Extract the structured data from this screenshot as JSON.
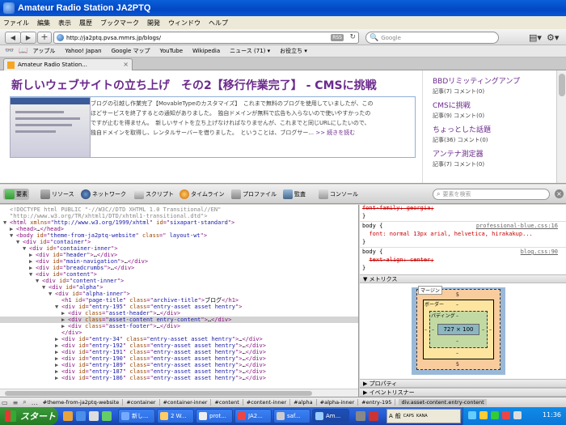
{
  "window": {
    "title": "Amateur Radio Station JA2PTQ"
  },
  "menu": [
    "ファイル",
    "編集",
    "表示",
    "履歴",
    "ブックマーク",
    "開発",
    "ウィンドウ",
    "ヘルプ"
  ],
  "nav": {
    "url": "http://ja2ptq.pvsa.mmrs.jp/blogs/",
    "rss_label": "RSS",
    "search_placeholder": "Google"
  },
  "bookmarks": [
    "アップル",
    "Yahoo! Japan",
    "Google マップ",
    "YouTube",
    "Wikipedia",
    "ニュース (71) ▾",
    "お役立ち ▾"
  ],
  "tab": {
    "label": "Amateur Radio Station...",
    "close": "×"
  },
  "page": {
    "post_title": "新しいウェブサイトの立ち上げ　その2【移行作業完了】",
    "post_title_suffix": " - CMSに挑戦",
    "post_lines": [
      "ブログの引越し作業完了【MovableTypeのカスタマイズ】　これまで無料のブログを使用していましたが、この",
      "ほどサービスを終了するとの通知がありました。　独自ドメインが無料で広告も入らないので使いやすかったの",
      "ですが止むを得ません。　新しいサイトを立ち上げなければなりませんが、これまでと同じURLにしたいので、",
      "独自ドメインを取得し、レンタルサーバーを借りました。　ということは、ブログサー..."
    ],
    "read_more": ">> 続きを読む",
    "sidebar": [
      {
        "title": "BBDリミッティングアンプ",
        "meta": "記事(7) コメント(0)"
      },
      {
        "title": "CMSに挑戦",
        "meta": "記事(9) コメント(0)"
      },
      {
        "title": "ちょっとした話題",
        "meta": "記事(36) コメント(0)"
      },
      {
        "title": "アンテナ測定器",
        "meta": "記事(7) コメント(0)"
      }
    ]
  },
  "inspector": {
    "tabs": [
      "要素",
      "リソース",
      "ネットワーク",
      "スクリプト",
      "タイムライン",
      "プロファイル",
      "監査",
      "コンソール"
    ],
    "search_placeholder": "要素を検索",
    "close": "×"
  },
  "dom": [
    {
      "indent": 0,
      "tw": "",
      "parts": [
        [
          "doc",
          "<!DOCTYPE html PUBLIC \"-//W3C//DTD XHTML 1.0 Transitional//EN\""
        ]
      ]
    },
    {
      "indent": 0,
      "tw": "",
      "parts": [
        [
          "doc",
          "\"http://www.w3.org/TR/xhtml1/DTD/xhtml1-transitional.dtd\">"
        ]
      ]
    },
    {
      "indent": 0,
      "tw": "▼",
      "parts": [
        [
          "tag",
          "<html "
        ],
        [
          "attr",
          "xmlns"
        ],
        [
          "tag",
          "=\""
        ],
        [
          "val",
          "http://www.w3.org/1999/xhtml"
        ],
        [
          "tag",
          "\" "
        ],
        [
          "attr",
          "id"
        ],
        [
          "tag",
          "=\""
        ],
        [
          "val",
          "sixapart-standard"
        ],
        [
          "tag",
          "\">"
        ]
      ]
    },
    {
      "indent": 1,
      "tw": "▶",
      "parts": [
        [
          "tag",
          "<head>"
        ],
        [
          "txt",
          "…"
        ],
        [
          "tag",
          "</head>"
        ]
      ]
    },
    {
      "indent": 1,
      "tw": "▼",
      "parts": [
        [
          "tag",
          "<body "
        ],
        [
          "attr",
          "id"
        ],
        [
          "tag",
          "=\""
        ],
        [
          "val",
          "theme-from-ja2ptq-website"
        ],
        [
          "tag",
          "\" "
        ],
        [
          "attr",
          "class"
        ],
        [
          "tag",
          "=\""
        ],
        [
          "val",
          " layout-wt"
        ],
        [
          "tag",
          "\">"
        ]
      ]
    },
    {
      "indent": 2,
      "tw": "▼",
      "parts": [
        [
          "tag",
          "<div "
        ],
        [
          "attr",
          "id"
        ],
        [
          "tag",
          "=\""
        ],
        [
          "val",
          "container"
        ],
        [
          "tag",
          "\">"
        ]
      ]
    },
    {
      "indent": 3,
      "tw": "▼",
      "parts": [
        [
          "tag",
          "<div "
        ],
        [
          "attr",
          "id"
        ],
        [
          "tag",
          "=\""
        ],
        [
          "val",
          "container-inner"
        ],
        [
          "tag",
          "\">"
        ]
      ]
    },
    {
      "indent": 4,
      "tw": "▶",
      "parts": [
        [
          "tag",
          "<div "
        ],
        [
          "attr",
          "id"
        ],
        [
          "tag",
          "=\""
        ],
        [
          "val",
          "header"
        ],
        [
          "tag",
          "\">"
        ],
        [
          "txt",
          "…"
        ],
        [
          "tag",
          "</div>"
        ]
      ]
    },
    {
      "indent": 4,
      "tw": "▶",
      "parts": [
        [
          "tag",
          "<div "
        ],
        [
          "attr",
          "id"
        ],
        [
          "tag",
          "=\""
        ],
        [
          "val",
          "main-navigation"
        ],
        [
          "tag",
          "\">"
        ],
        [
          "txt",
          "…"
        ],
        [
          "tag",
          "</div>"
        ]
      ]
    },
    {
      "indent": 4,
      "tw": "▶",
      "parts": [
        [
          "tag",
          "<div "
        ],
        [
          "attr",
          "id"
        ],
        [
          "tag",
          "=\""
        ],
        [
          "val",
          "breadcrumbs"
        ],
        [
          "tag",
          "\">"
        ],
        [
          "txt",
          "…"
        ],
        [
          "tag",
          "</div>"
        ]
      ]
    },
    {
      "indent": 4,
      "tw": "▼",
      "parts": [
        [
          "tag",
          "<div "
        ],
        [
          "attr",
          "id"
        ],
        [
          "tag",
          "=\""
        ],
        [
          "val",
          "content"
        ],
        [
          "tag",
          "\">"
        ]
      ]
    },
    {
      "indent": 5,
      "tw": "▼",
      "parts": [
        [
          "tag",
          "<div "
        ],
        [
          "attr",
          "id"
        ],
        [
          "tag",
          "=\""
        ],
        [
          "val",
          "content-inner"
        ],
        [
          "tag",
          "\">"
        ]
      ]
    },
    {
      "indent": 6,
      "tw": "▼",
      "parts": [
        [
          "tag",
          "<div "
        ],
        [
          "attr",
          "id"
        ],
        [
          "tag",
          "=\""
        ],
        [
          "val",
          "alpha"
        ],
        [
          "tag",
          "\">"
        ]
      ]
    },
    {
      "indent": 7,
      "tw": "▼",
      "parts": [
        [
          "tag",
          "<div "
        ],
        [
          "attr",
          "id"
        ],
        [
          "tag",
          "=\""
        ],
        [
          "val",
          "alpha-inner"
        ],
        [
          "tag",
          "\">"
        ]
      ]
    },
    {
      "indent": 8,
      "tw": "",
      "parts": [
        [
          "tag",
          "<h1 "
        ],
        [
          "attr",
          "id"
        ],
        [
          "tag",
          "=\""
        ],
        [
          "val",
          "page-title"
        ],
        [
          "tag",
          "\" "
        ],
        [
          "attr",
          "class"
        ],
        [
          "tag",
          "=\""
        ],
        [
          "val",
          "archive-title"
        ],
        [
          "tag",
          "\">"
        ],
        [
          "txt",
          "ブログ"
        ],
        [
          "tag",
          "</h1>"
        ]
      ]
    },
    {
      "indent": 8,
      "tw": "▼",
      "parts": [
        [
          "tag",
          "<div "
        ],
        [
          "attr",
          "id"
        ],
        [
          "tag",
          "=\""
        ],
        [
          "val",
          "entry-195"
        ],
        [
          "tag",
          "\" "
        ],
        [
          "attr",
          "class"
        ],
        [
          "tag",
          "=\""
        ],
        [
          "val",
          "entry-asset asset hentry"
        ],
        [
          "tag",
          "\">"
        ]
      ]
    },
    {
      "indent": 9,
      "tw": "▶",
      "parts": [
        [
          "tag",
          "<div "
        ],
        [
          "attr",
          "class"
        ],
        [
          "tag",
          "=\""
        ],
        [
          "val",
          "asset-header"
        ],
        [
          "tag",
          "\">"
        ],
        [
          "txt",
          "…"
        ],
        [
          "tag",
          "</div>"
        ]
      ]
    },
    {
      "indent": 9,
      "tw": "▶",
      "sel": true,
      "parts": [
        [
          "tag",
          "<div "
        ],
        [
          "attr",
          "class"
        ],
        [
          "tag",
          "=\""
        ],
        [
          "val",
          "asset-content entry-content"
        ],
        [
          "tag",
          "\">"
        ],
        [
          "txt",
          "…"
        ],
        [
          "tag",
          "</div>"
        ]
      ]
    },
    {
      "indent": 9,
      "tw": "▶",
      "parts": [
        [
          "tag",
          "<div "
        ],
        [
          "attr",
          "class"
        ],
        [
          "tag",
          "=\""
        ],
        [
          "val",
          "asset-footer"
        ],
        [
          "tag",
          "\">"
        ],
        [
          "txt",
          "…"
        ],
        [
          "tag",
          "</div>"
        ]
      ]
    },
    {
      "indent": 8,
      "tw": "",
      "parts": [
        [
          "tag",
          "</div>"
        ]
      ]
    },
    {
      "indent": 8,
      "tw": "▶",
      "parts": [
        [
          "tag",
          "<div "
        ],
        [
          "attr",
          "id"
        ],
        [
          "tag",
          "=\""
        ],
        [
          "val",
          "entry-34"
        ],
        [
          "tag",
          "\" "
        ],
        [
          "attr",
          "class"
        ],
        [
          "tag",
          "=\""
        ],
        [
          "val",
          "entry-asset asset hentry"
        ],
        [
          "tag",
          "\">"
        ],
        [
          "txt",
          "…"
        ],
        [
          "tag",
          "</div>"
        ]
      ]
    },
    {
      "indent": 8,
      "tw": "▶",
      "parts": [
        [
          "tag",
          "<div "
        ],
        [
          "attr",
          "id"
        ],
        [
          "tag",
          "=\""
        ],
        [
          "val",
          "entry-192"
        ],
        [
          "tag",
          "\" "
        ],
        [
          "attr",
          "class"
        ],
        [
          "tag",
          "=\""
        ],
        [
          "val",
          "entry-asset asset hentry"
        ],
        [
          "tag",
          "\">"
        ],
        [
          "txt",
          "…"
        ],
        [
          "tag",
          "</div>"
        ]
      ]
    },
    {
      "indent": 8,
      "tw": "▶",
      "parts": [
        [
          "tag",
          "<div "
        ],
        [
          "attr",
          "id"
        ],
        [
          "tag",
          "=\""
        ],
        [
          "val",
          "entry-191"
        ],
        [
          "tag",
          "\" "
        ],
        [
          "attr",
          "class"
        ],
        [
          "tag",
          "=\""
        ],
        [
          "val",
          "entry-asset asset hentry"
        ],
        [
          "tag",
          "\">"
        ],
        [
          "txt",
          "…"
        ],
        [
          "tag",
          "</div>"
        ]
      ]
    },
    {
      "indent": 8,
      "tw": "▶",
      "parts": [
        [
          "tag",
          "<div "
        ],
        [
          "attr",
          "id"
        ],
        [
          "tag",
          "=\""
        ],
        [
          "val",
          "entry-190"
        ],
        [
          "tag",
          "\" "
        ],
        [
          "attr",
          "class"
        ],
        [
          "tag",
          "=\""
        ],
        [
          "val",
          "entry-asset asset hentry"
        ],
        [
          "tag",
          "\">"
        ],
        [
          "txt",
          "…"
        ],
        [
          "tag",
          "</div>"
        ]
      ]
    },
    {
      "indent": 8,
      "tw": "▶",
      "parts": [
        [
          "tag",
          "<div "
        ],
        [
          "attr",
          "id"
        ],
        [
          "tag",
          "=\""
        ],
        [
          "val",
          "entry-189"
        ],
        [
          "tag",
          "\" "
        ],
        [
          "attr",
          "class"
        ],
        [
          "tag",
          "=\""
        ],
        [
          "val",
          "entry-asset asset hentry"
        ],
        [
          "tag",
          "\">"
        ],
        [
          "txt",
          "…"
        ],
        [
          "tag",
          "</div>"
        ]
      ]
    },
    {
      "indent": 8,
      "tw": "▶",
      "parts": [
        [
          "tag",
          "<div "
        ],
        [
          "attr",
          "id"
        ],
        [
          "tag",
          "=\""
        ],
        [
          "val",
          "entry-187"
        ],
        [
          "tag",
          "\" "
        ],
        [
          "attr",
          "class"
        ],
        [
          "tag",
          "=\""
        ],
        [
          "val",
          "entry-asset asset hentry"
        ],
        [
          "tag",
          "\">"
        ],
        [
          "txt",
          "…"
        ],
        [
          "tag",
          "</div>"
        ]
      ]
    },
    {
      "indent": 8,
      "tw": "▶",
      "parts": [
        [
          "tag",
          "<div "
        ],
        [
          "attr",
          "id"
        ],
        [
          "tag",
          "=\""
        ],
        [
          "val",
          "entry-186"
        ],
        [
          "tag",
          "\" "
        ],
        [
          "attr",
          "class"
        ],
        [
          "tag",
          "=\""
        ],
        [
          "val",
          "entry-asset asset hentry"
        ],
        [
          "tag",
          "\">"
        ],
        [
          "txt",
          "…"
        ],
        [
          "tag",
          "</div>"
        ]
      ]
    }
  ],
  "styles": {
    "rule1_prop": "font-family: georgia;",
    "rule2_selector": "body {",
    "rule2_link": "professional-blue.css:16",
    "rule2_prop": "font: normal 13px arial, helvetica, hirakakup...",
    "rule3_selector": "body {",
    "rule3_link": "blog.css:90",
    "rule3_prop": "text-align: center;",
    "close_brace": "}",
    "metrics_header": "▼ メトリクス",
    "props_header": "▶ プロパティ",
    "listeners_header": "▶ イベントリスナー",
    "box": {
      "margin_label": "マージン",
      "border_label": "ボーダー",
      "padding_label": "パディング",
      "content": "727 × 100",
      "margin_top": "5",
      "margin_bottom": "5",
      "dash": "–"
    }
  },
  "breadcrumbs": [
    "#theme-from-ja2ptq-website",
    "#container",
    "#container-inner",
    "#content",
    "#content-inner",
    "#alpha",
    "#alpha-inner",
    "#entry-195",
    "div.asset-content.entry-content"
  ],
  "taskbar": {
    "start": "スタート",
    "tasks": [
      "新し...",
      "2 W...",
      "prot...",
      "JA2...",
      "saf...",
      "Am..."
    ],
    "ime": [
      "A",
      "般",
      "CAPS",
      "KANA"
    ],
    "clock": "11:36"
  },
  "colors": {
    "link": "#6b2a8c",
    "titlebar": "#0347c4",
    "start": "#2e8b2e"
  }
}
